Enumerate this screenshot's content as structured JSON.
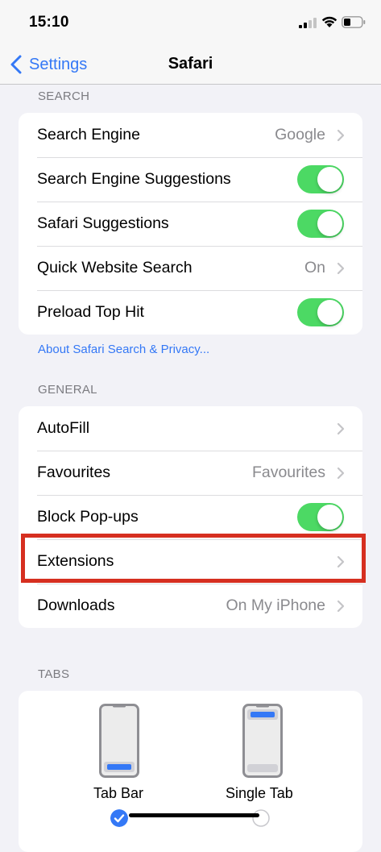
{
  "status": {
    "time": "15:10"
  },
  "nav": {
    "back_label": "Settings",
    "title": "Safari"
  },
  "search": {
    "header": "SEARCH",
    "rows": [
      {
        "label": "Search Engine",
        "value": "Google",
        "control": "chevron"
      },
      {
        "label": "Search Engine Suggestions",
        "control": "toggle",
        "on": true
      },
      {
        "label": "Safari Suggestions",
        "control": "toggle",
        "on": true
      },
      {
        "label": "Quick Website Search",
        "value": "On",
        "control": "chevron"
      },
      {
        "label": "Preload Top Hit",
        "control": "toggle",
        "on": true
      }
    ],
    "footer_link": "About Safari Search & Privacy..."
  },
  "general": {
    "header": "GENERAL",
    "rows": [
      {
        "label": "AutoFill",
        "control": "chevron"
      },
      {
        "label": "Favourites",
        "value": "Favourites",
        "control": "chevron"
      },
      {
        "label": "Block Pop-ups",
        "control": "toggle",
        "on": true
      },
      {
        "label": "Extensions",
        "control": "chevron"
      },
      {
        "label": "Downloads",
        "value": "On My iPhone",
        "control": "chevron"
      }
    ]
  },
  "tabs": {
    "header": "TABS",
    "options": [
      {
        "label": "Tab Bar",
        "selected": true
      },
      {
        "label": "Single Tab",
        "selected": false
      }
    ]
  },
  "colors": {
    "accent": "#3478f6",
    "toggle_on": "#4cd964",
    "highlight": "#d62f20"
  }
}
